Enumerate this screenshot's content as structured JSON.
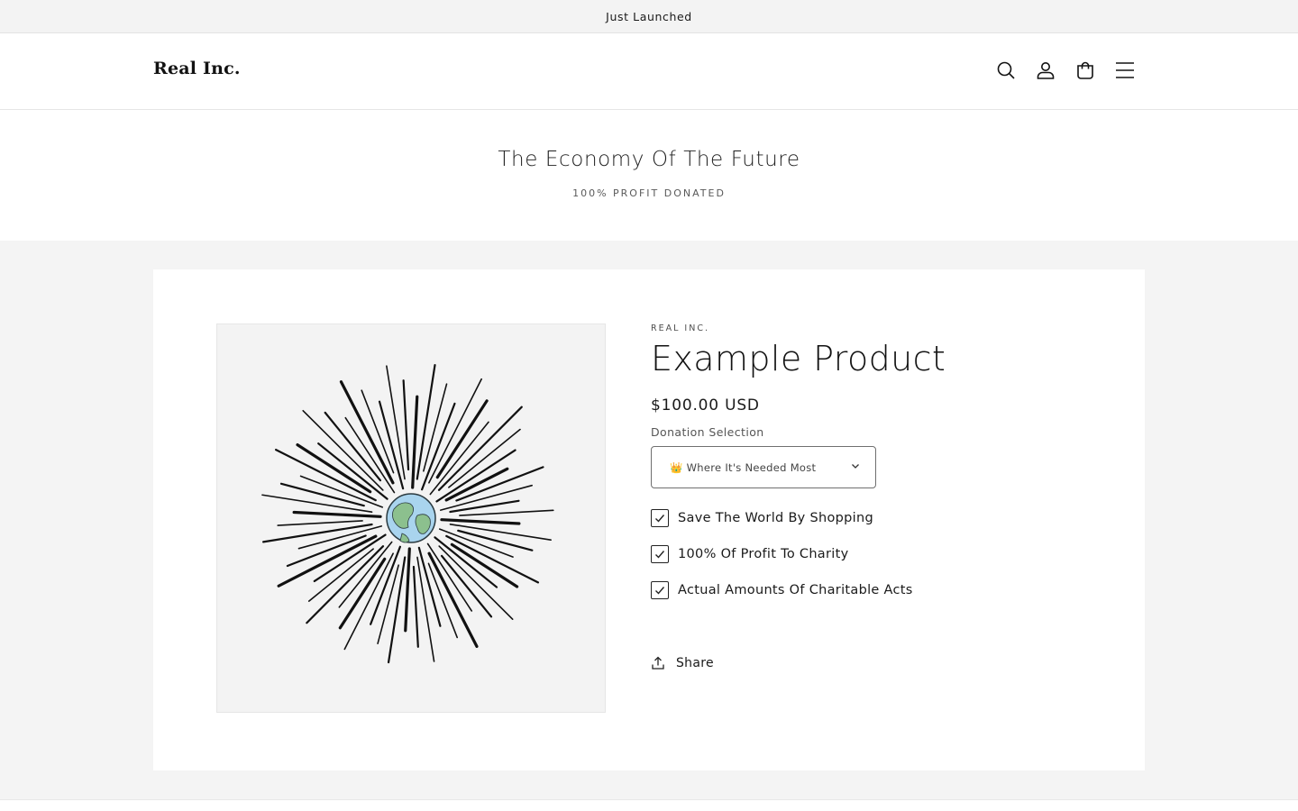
{
  "announcement": {
    "text": "Just Launched"
  },
  "header": {
    "logo": "Real Inc.",
    "icons": [
      "search-icon",
      "account-icon",
      "cart-icon",
      "menu-icon"
    ]
  },
  "hero": {
    "title": "The Economy Of The Future",
    "subtitle": "100% PROFIT DONATED"
  },
  "product": {
    "vendor": "REAL INC.",
    "title": "Example Product",
    "price": "$100.00 USD",
    "select": {
      "label": "Donation Selection",
      "value": "👑 Where It's Needed Most"
    },
    "checks": [
      {
        "label": "Save The World By Shopping",
        "checked": true
      },
      {
        "label": "100% Of Profit To Charity",
        "checked": true
      },
      {
        "label": "Actual Amounts Of Charitable Acts",
        "checked": true
      }
    ],
    "share_label": "Share"
  },
  "colors": {
    "text": "#121212",
    "section_bg": "#f4f4f4",
    "announcement_bg": "#f3f3f3",
    "globe_ocean": "#a9d4ee",
    "globe_land": "#8cc08e"
  }
}
